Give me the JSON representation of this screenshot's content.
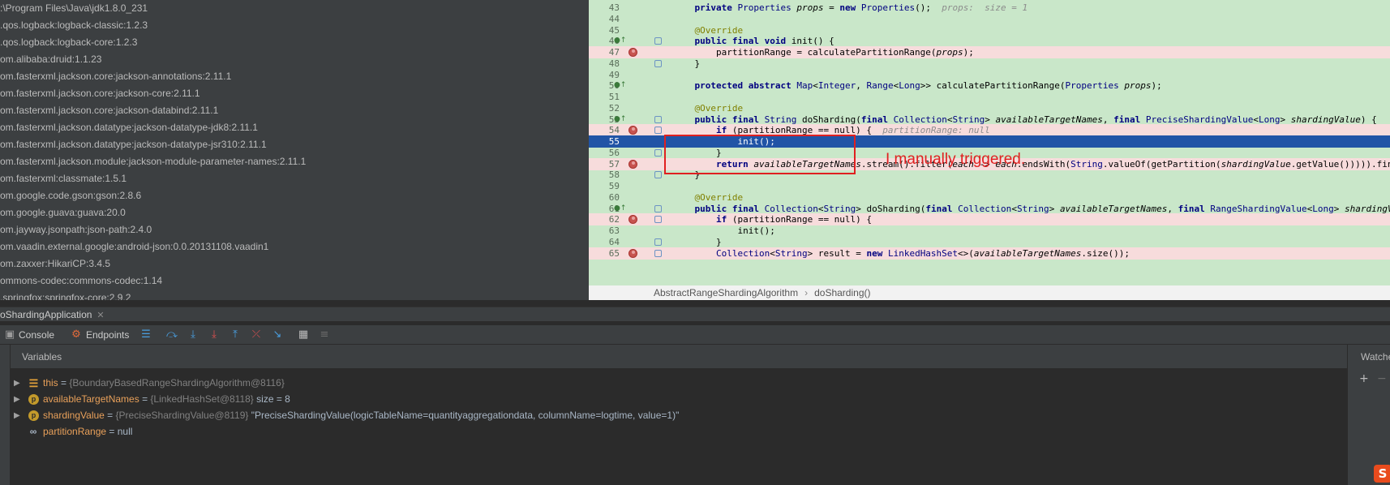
{
  "dependencies": [
    ":\\Program Files\\Java\\jdk1.8.0_231",
    ".qos.logback:logback-classic:1.2.3",
    ".qos.logback:logback-core:1.2.3",
    "om.alibaba:druid:1.1.23",
    "om.fasterxml.jackson.core:jackson-annotations:2.11.1",
    "om.fasterxml.jackson.core:jackson-core:2.11.1",
    "om.fasterxml.jackson.core:jackson-databind:2.11.1",
    "om.fasterxml.jackson.datatype:jackson-datatype-jdk8:2.11.1",
    "om.fasterxml.jackson.datatype:jackson-datatype-jsr310:2.11.1",
    "om.fasterxml.jackson.module:jackson-module-parameter-names:2.11.1",
    "om.fasterxml:classmate:1.5.1",
    "om.google.code.gson:gson:2.8.6",
    "om.google.guava:guava:20.0",
    "om.jayway.jsonpath:json-path:2.4.0",
    "om.vaadin.external.google:android-json:0.0.20131108.vaadin1",
    "om.zaxxer:HikariCP:3.4.5",
    "ommons-codec:commons-codec:1.14",
    ".springfox:springfox-core:2.9.2"
  ],
  "editor": {
    "lines": [
      {
        "n": "43",
        "text": "    private Properties props = new Properties();",
        "hint": "  props:  size = 1",
        "state": "normal"
      },
      {
        "n": "44",
        "text": "",
        "hint": "",
        "state": "normal"
      },
      {
        "n": "45",
        "text": "    @Override",
        "hint": "",
        "state": "normal"
      },
      {
        "n": "46",
        "text": "    public final void init() {",
        "hint": "",
        "state": "normal"
      },
      {
        "n": "47",
        "text": "        partitionRange = calculatePartitionRange(props);",
        "hint": "",
        "state": "error"
      },
      {
        "n": "48",
        "text": "    }",
        "hint": "",
        "state": "normal"
      },
      {
        "n": "49",
        "text": "",
        "hint": "",
        "state": "normal"
      },
      {
        "n": "50",
        "text": "    protected abstract Map<Integer, Range<Long>> calculatePartitionRange(Properties props);",
        "hint": "",
        "state": "normal"
      },
      {
        "n": "51",
        "text": "",
        "hint": "",
        "state": "normal"
      },
      {
        "n": "52",
        "text": "    @Override",
        "hint": "",
        "state": "normal"
      },
      {
        "n": "53",
        "text": "    public final String doSharding(final Collection<String> availableTargetNames, final PreciseShardingValue<Long> shardingValue) {",
        "hint": "",
        "state": "normal"
      },
      {
        "n": "54",
        "text": "        if (partitionRange == null) {",
        "hint": "  partitionRange: null",
        "state": "error"
      },
      {
        "n": "55",
        "text": "            init();",
        "hint": "",
        "state": "selected"
      },
      {
        "n": "56",
        "text": "        }",
        "hint": "",
        "state": "normal"
      },
      {
        "n": "57",
        "text": "        return availableTargetNames.stream().filter(each -> each.endsWith(String.valueOf(getPartition(shardingValue.getValue())))).findFirst().orElse(null);",
        "hint": "",
        "state": "error"
      },
      {
        "n": "58",
        "text": "    }",
        "hint": "",
        "state": "normal"
      },
      {
        "n": "59",
        "text": "",
        "hint": "",
        "state": "normal"
      },
      {
        "n": "60",
        "text": "    @Override",
        "hint": "",
        "state": "normal"
      },
      {
        "n": "61",
        "text": "    public final Collection<String> doSharding(final Collection<String> availableTargetNames, final RangeShardingValue<Long> shardingValue) {",
        "hint": "",
        "state": "normal"
      },
      {
        "n": "62",
        "text": "        if (partitionRange == null) {",
        "hint": "",
        "state": "error"
      },
      {
        "n": "63",
        "text": "            init();",
        "hint": "",
        "state": "normal"
      },
      {
        "n": "64",
        "text": "        }",
        "hint": "",
        "state": "normal"
      },
      {
        "n": "65",
        "text": "        Collection<String> result = new LinkedHashSet<>(availableTargetNames.size());",
        "hint": "",
        "state": "error"
      }
    ],
    "breadcrumb": {
      "class_name": "AbstractRangeShardingAlgorithm",
      "method_name": "doSharding()"
    }
  },
  "annotation": {
    "text": "I manually triggered."
  },
  "debug": {
    "run_tab": "oShardingApplication",
    "toolbar": {
      "console_label": "Console",
      "endpoints_label": "Endpoints"
    },
    "variables_title": "Variables",
    "watches_title": "Watche",
    "variables": [
      {
        "name": "this",
        "eq": " = ",
        "type": "{BoundaryBasedRangeShardingAlgorithm@8116}",
        "extra": "",
        "icon": "lines-icon",
        "expandable": true
      },
      {
        "name": "availableTargetNames",
        "eq": " = ",
        "type": "{LinkedHashSet@8118}",
        "extra": "  size = 8",
        "icon": "param-icon",
        "expandable": true
      },
      {
        "name": "shardingValue",
        "eq": " = ",
        "type": "{PreciseShardingValue@8119}",
        "extra": " \"PreciseShardingValue(logicTableName=quantityaggregationdata, columnName=logtime, value=1)\"",
        "icon": "param-icon",
        "expandable": true
      },
      {
        "name": "partitionRange",
        "eq": " = ",
        "type": "",
        "extra": "null",
        "icon": "watch-glasses-icon",
        "expandable": false
      }
    ]
  },
  "colors": {
    "accent_blue": "#2154a6",
    "annotation_red": "#e02020",
    "editor_bg": "#c9e7c9"
  }
}
